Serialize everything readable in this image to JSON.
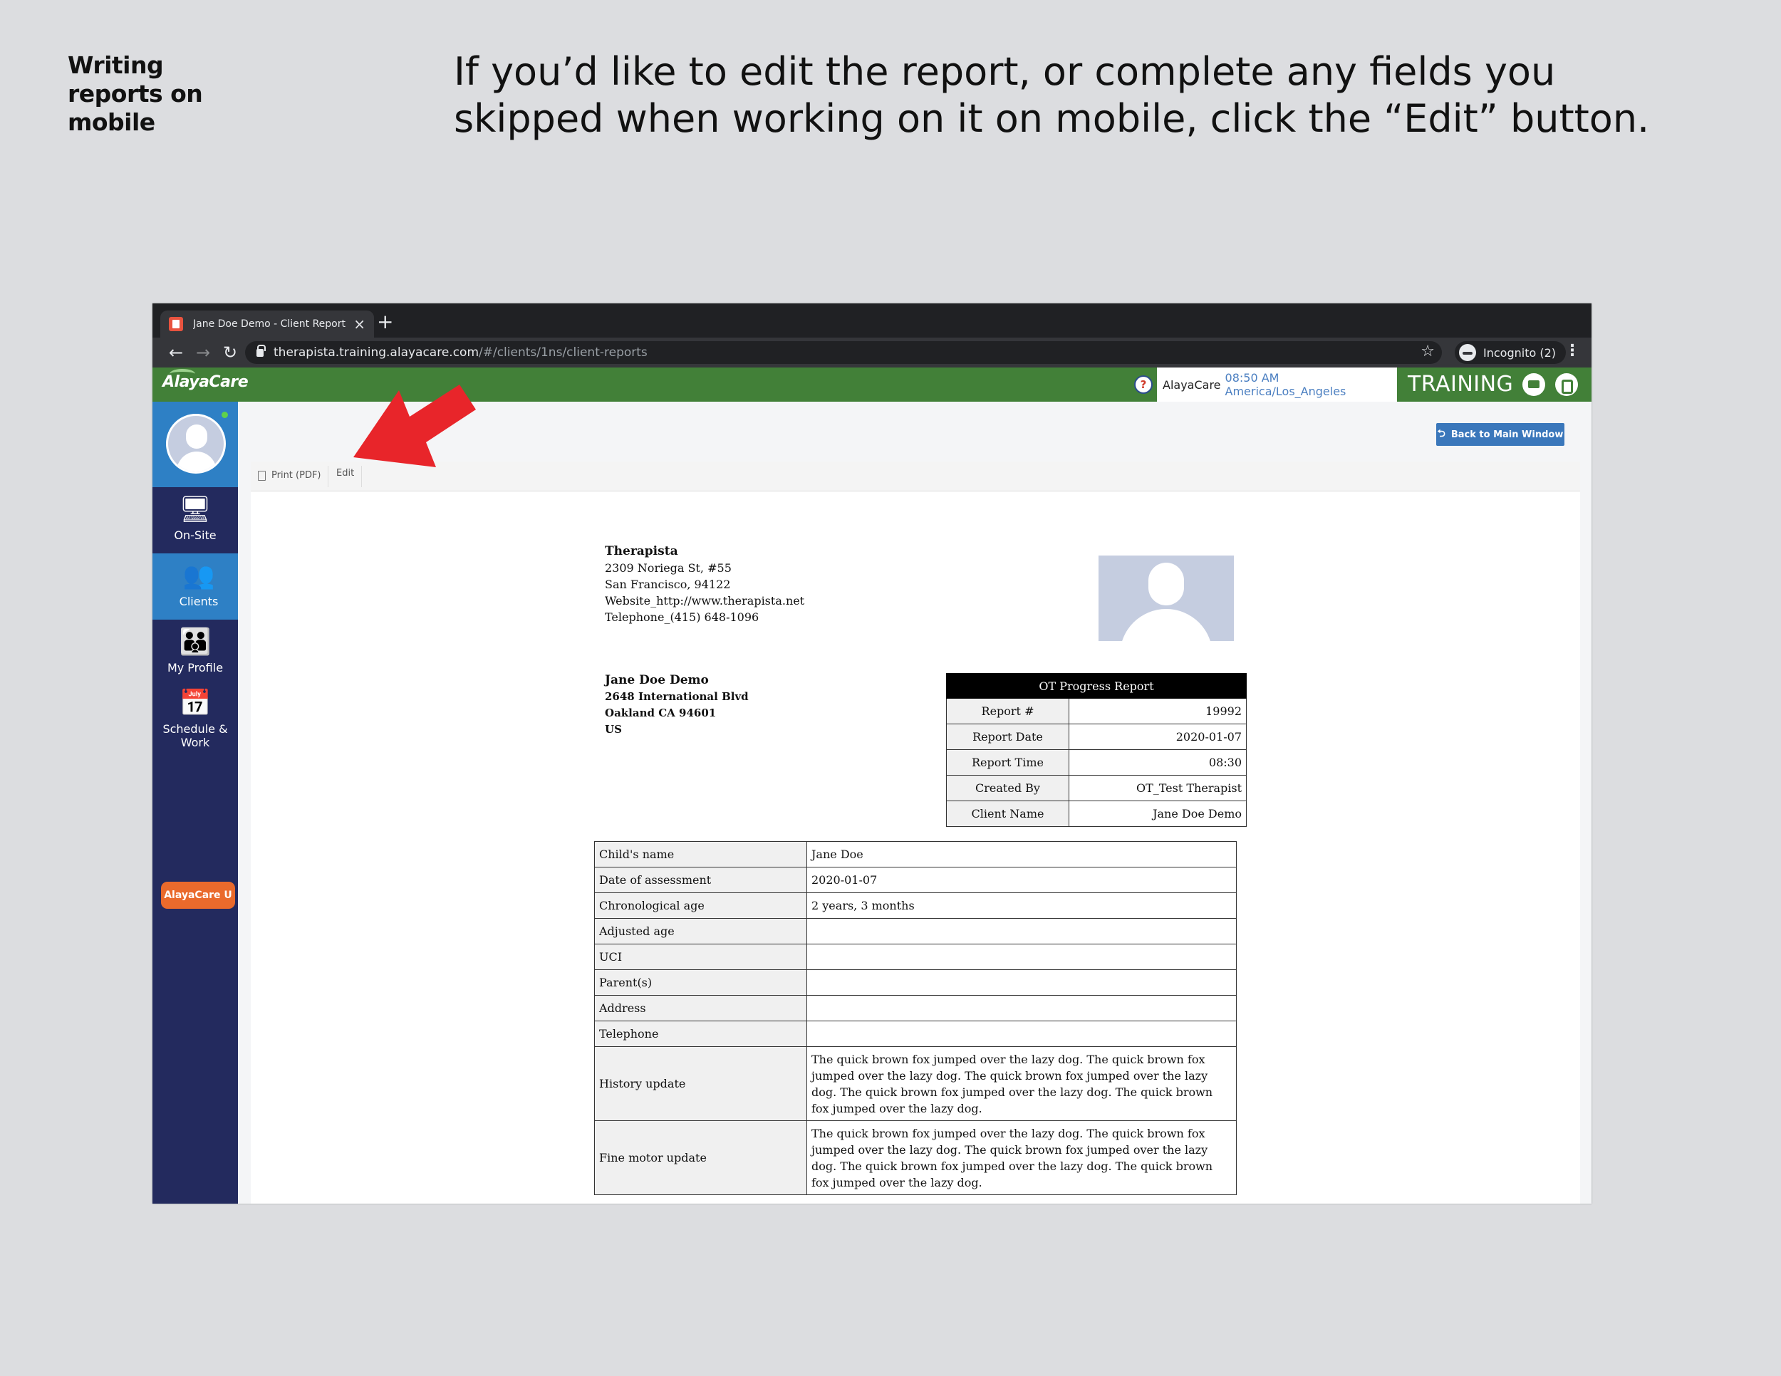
{
  "slide": {
    "side_title": "Writing reports on mobile",
    "heading": "If you’d like to edit the report, or complete any fields you skipped when working on it on mobile, click the “Edit” button."
  },
  "browser": {
    "tab_title": "Jane Doe Demo - Client Report",
    "new_tab": "+",
    "url_host": "therapista.training.alayacare.com",
    "url_path": "/#/clients/1ns/client-reports",
    "incognito_label": "Incognito (2)"
  },
  "app": {
    "logo": "AlayaCare",
    "org_name": "AlayaCare",
    "time_tz": "08:50 AM America/Los_Angeles",
    "env_label": "TRAINING",
    "help": "?"
  },
  "sidebar": {
    "items": [
      {
        "label": "On-Site",
        "icon": "monitor-icon"
      },
      {
        "label": "Clients",
        "icon": "users-icon"
      },
      {
        "label": "My Profile",
        "icon": "team-icon"
      },
      {
        "label": "Schedule & Work",
        "icon": "calendar-icon"
      }
    ],
    "badge": "AlayaCare U"
  },
  "toolbar": {
    "back_label": "Back to Main Window",
    "print_label": "Print (PDF)",
    "edit_label": "Edit"
  },
  "company": {
    "name": "Therapista",
    "street": "2309 Noriega St, #55",
    "city": "San Francisco,   94122",
    "website": "Website_http://www.therapista.net",
    "telephone": "Telephone_(415) 648-1096"
  },
  "client": {
    "name": "Jane Doe Demo",
    "street": "2648 International Blvd",
    "city": "Oakland CA 94601",
    "country": "US"
  },
  "report": {
    "title": "OT Progress Report",
    "rows": [
      {
        "k": "Report #",
        "v": "19992"
      },
      {
        "k": "Report Date",
        "v": "2020-01-07"
      },
      {
        "k": "Report Time",
        "v": "08:30"
      },
      {
        "k": "Created By",
        "v": "OT_Test Therapist"
      },
      {
        "k": "Client Name",
        "v": "Jane Doe Demo"
      }
    ]
  },
  "details": {
    "rows": [
      {
        "k": "Child's name",
        "v": "Jane Doe"
      },
      {
        "k": "Date of assessment",
        "v": "2020-01-07"
      },
      {
        "k": "Chronological age",
        "v": "2 years, 3 months"
      },
      {
        "k": "Adjusted age",
        "v": ""
      },
      {
        "k": "UCI",
        "v": ""
      },
      {
        "k": "Parent(s)",
        "v": ""
      },
      {
        "k": "Address",
        "v": ""
      },
      {
        "k": "Telephone",
        "v": ""
      },
      {
        "k": "History update",
        "v": "The quick brown fox jumped over the lazy dog. The quick brown fox jumped over the lazy dog. The quick brown fox jumped over the lazy dog. The quick brown fox jumped over the lazy dog. The quick brown fox jumped over the lazy dog."
      },
      {
        "k": "Fine motor update",
        "v": "The quick brown fox jumped over the lazy dog. The quick brown fox jumped over the lazy dog. The quick brown fox jumped over the lazy dog. The quick brown fox jumped over the lazy dog. The quick brown fox jumped over the lazy dog."
      }
    ]
  },
  "colors": {
    "appbar_green": "#428038",
    "sidebar_navy": "#232a5e",
    "active_blue": "#2e80c5",
    "badge_orange": "#ea6a2c",
    "arrow_red": "#e8252a"
  }
}
